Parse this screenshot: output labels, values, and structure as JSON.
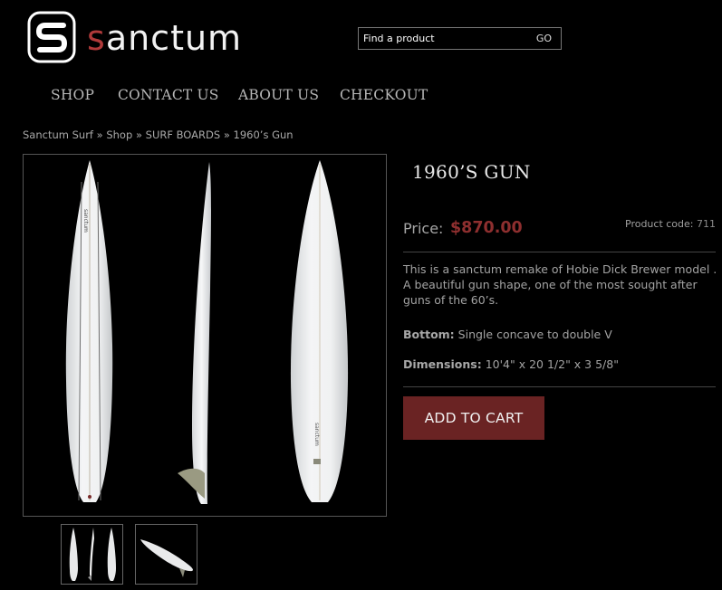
{
  "brand": {
    "name": "sanctum",
    "name_first": "s",
    "name_rest": "anctum"
  },
  "search": {
    "placeholder": "Find a product",
    "button_label": "GO"
  },
  "nav": {
    "items": [
      {
        "label": "SHOP"
      },
      {
        "label": "CONTACT US"
      },
      {
        "label": "ABOUT US"
      },
      {
        "label": "CHECKOUT"
      }
    ]
  },
  "breadcrumb": {
    "items": [
      "Sanctum Surf",
      "Shop",
      "SURF BOARDS",
      "1960’s Gun"
    ],
    "separator": "»"
  },
  "product": {
    "title": "1960’S GUN",
    "price_label": "Price:",
    "price": "$870.00",
    "code_label": "Product code:",
    "code": "711",
    "description": "This is a sanctum remake of Hobie Dick Brewer model . A beautiful gun shape, one of the most sought after guns of the 60’s.",
    "bottom_label": "Bottom:",
    "bottom_value": "Single concave to double V",
    "dimensions_label": "Dimensions:",
    "dimensions_value": "10'4\" x 20 1/2\" x 3 5/8\"",
    "add_to_cart": "ADD TO CART",
    "board_logo_text": "sanctum"
  },
  "colors": {
    "accent": "#6a2323",
    "price": "#8e2f2f",
    "background": "#000000"
  },
  "icons": {
    "search": "none",
    "thumbnails": [
      "board-three-views-thumbnail",
      "board-angled-thumbnail"
    ]
  }
}
